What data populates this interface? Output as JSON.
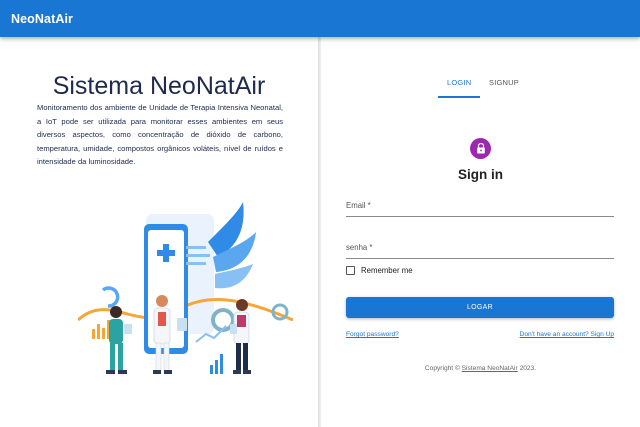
{
  "appbar": {
    "brand": "NeoNatAir"
  },
  "intro": {
    "title": "Sistema NeoNatAir",
    "description": "Monitoramento dos ambiente de Unidade de Terapia Intensiva Neonatal, a IoT pode ser utilizada para monitorar esses ambientes em seus diversos aspectos, como concentração de dióxido de carbono, temperatura, umidade, compostos orgânicos voláteis, nível de ruídos e intensidade da luminosidade."
  },
  "tabs": [
    {
      "label": "LOGIN",
      "active": true
    },
    {
      "label": "SIGNUP",
      "active": false
    }
  ],
  "form": {
    "heading": "Sign in",
    "email_label": "Email *",
    "password_label": "senha *",
    "remember_label": "Remember me",
    "remember_checked": false,
    "submit_label": "LOGAR",
    "forgot_link": "Forgot password?",
    "signup_link": "Don't have an account? Sign Up"
  },
  "footer": {
    "prefix": "Copyright © ",
    "link": "Sistema NeoNatAir",
    "suffix": " 2023."
  },
  "colors": {
    "primary": "#1976d2",
    "avatar": "#9c27b0",
    "title_text": "#1d2a4e"
  },
  "icons": {
    "lock": "lock-icon",
    "checkbox": "checkbox-icon"
  }
}
